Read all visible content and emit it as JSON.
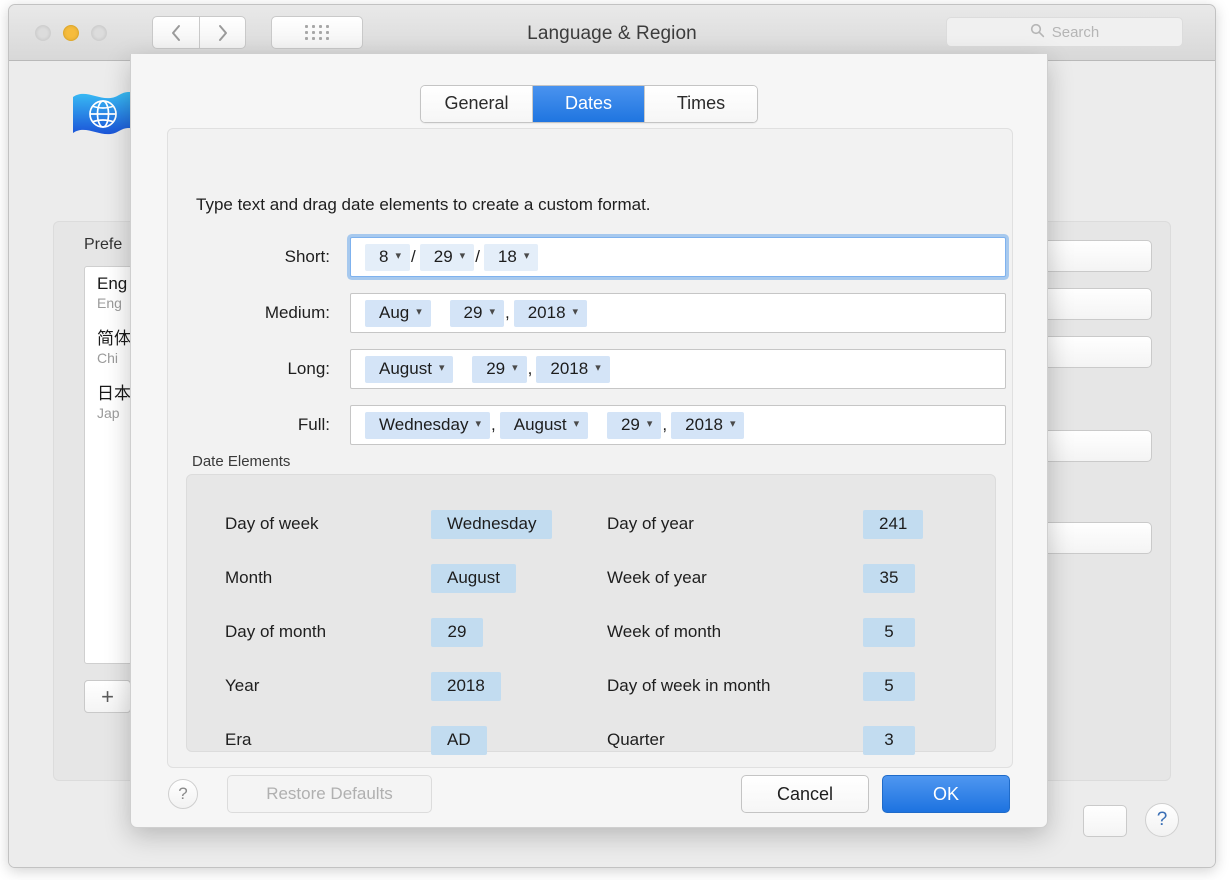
{
  "window": {
    "title": "Language & Region",
    "search_placeholder": "Search",
    "traffic_lights": [
      "close-button",
      "minimize-button",
      "zoom-button"
    ],
    "nav_back": "‹",
    "nav_forward": "›",
    "icon": "globe-flag-icon"
  },
  "sidebar": {
    "preferred_label": "Prefe",
    "languages": [
      {
        "name": "Eng",
        "sub": "Eng"
      },
      {
        "name": "简体",
        "sub": "Chi"
      },
      {
        "name": "日本",
        "sub": "Jap"
      }
    ],
    "add_button": "+"
  },
  "sheet": {
    "tabs": [
      {
        "label": "General",
        "selected": false
      },
      {
        "label": "Dates",
        "selected": true
      },
      {
        "label": "Times",
        "selected": false
      }
    ],
    "hint": "Type text and drag date elements to create a custom format.",
    "formats": [
      {
        "label": "Short:",
        "focused": true,
        "pale": true,
        "parts": [
          {
            "kind": "token",
            "text": "8"
          },
          {
            "kind": "sep",
            "text": "/"
          },
          {
            "kind": "token",
            "text": "29"
          },
          {
            "kind": "sep",
            "text": "/"
          },
          {
            "kind": "token",
            "text": "18"
          }
        ]
      },
      {
        "label": "Medium:",
        "focused": false,
        "pale": false,
        "parts": [
          {
            "kind": "token",
            "text": "Aug"
          },
          {
            "kind": "token",
            "text": "29"
          },
          {
            "kind": "sep",
            "text": ","
          },
          {
            "kind": "token",
            "text": "2018"
          }
        ]
      },
      {
        "label": "Long:",
        "focused": false,
        "pale": false,
        "parts": [
          {
            "kind": "token",
            "text": "August"
          },
          {
            "kind": "token",
            "text": "29"
          },
          {
            "kind": "sep",
            "text": ","
          },
          {
            "kind": "token",
            "text": "2018"
          }
        ]
      },
      {
        "label": "Full:",
        "focused": false,
        "pale": false,
        "parts": [
          {
            "kind": "token",
            "text": "Wednesday"
          },
          {
            "kind": "sep",
            "text": ","
          },
          {
            "kind": "token",
            "text": "August"
          },
          {
            "kind": "token",
            "text": "29"
          },
          {
            "kind": "sep",
            "text": ","
          },
          {
            "kind": "token",
            "text": "2018"
          }
        ]
      }
    ],
    "date_elements": {
      "title": "Date Elements",
      "left": [
        {
          "name": "Day of week",
          "value": "Wednesday"
        },
        {
          "name": "Month",
          "value": "August"
        },
        {
          "name": "Day of month",
          "value": "29"
        },
        {
          "name": "Year",
          "value": "2018"
        },
        {
          "name": "Era",
          "value": "AD"
        }
      ],
      "right": [
        {
          "name": "Day of year",
          "value": "241"
        },
        {
          "name": "Week of year",
          "value": "35"
        },
        {
          "name": "Week of month",
          "value": "5"
        },
        {
          "name": "Day of week in month",
          "value": "5"
        },
        {
          "name": "Quarter",
          "value": "3"
        }
      ]
    },
    "footer": {
      "help": "?",
      "restore_defaults": "Restore Defaults",
      "cancel": "Cancel",
      "ok": "OK"
    }
  },
  "main_help_button": "?",
  "colors": {
    "accent_blue": "#1f75e0",
    "token_blue": "#d4e4f7",
    "token_blue_pale": "#e4eef9",
    "element_value_blue": "#c2dcf0",
    "minimize_yellow": "#f6bc3c",
    "help_blue": "#3a6fb5"
  }
}
